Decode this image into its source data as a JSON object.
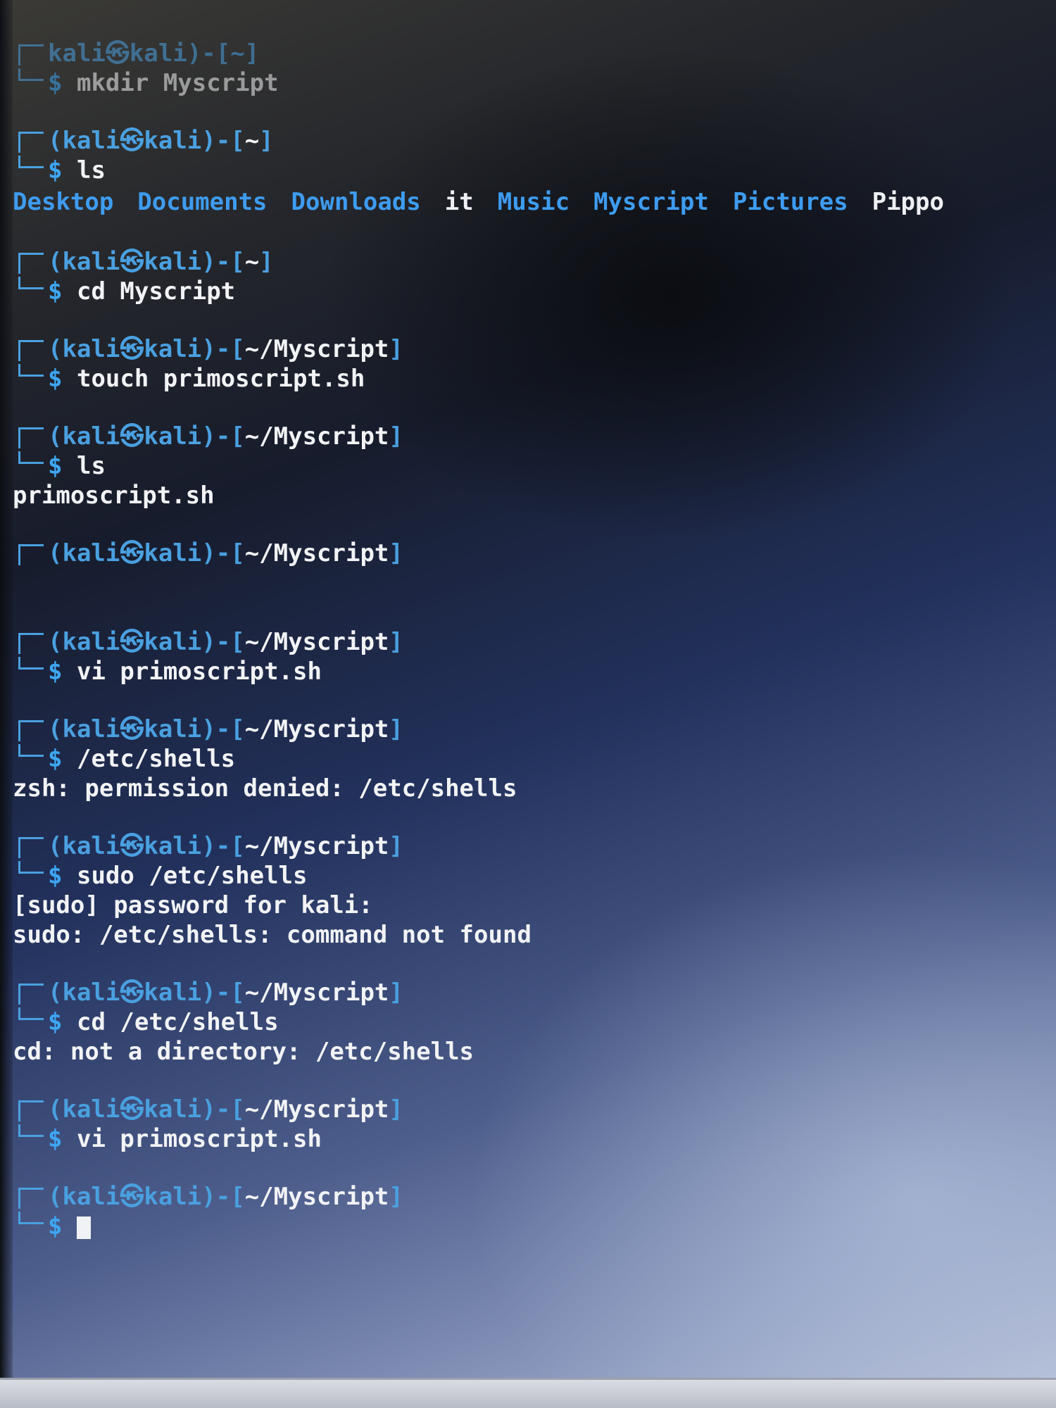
{
  "prompt": {
    "user": "kali",
    "at_symbol": "㉿",
    "host": "kali",
    "dollar": "$",
    "color_prompt": "#4aa0e0",
    "color_dir": "#3e9cf0",
    "color_text": "#e6e8ec"
  },
  "entries": [
    {
      "path": "~",
      "command": "mkdir Myscript",
      "output": []
    },
    {
      "path": "~",
      "command": "ls",
      "output": []
    },
    {
      "path": "~",
      "command": "cd Myscript",
      "output": []
    },
    {
      "path": "~/Myscript",
      "command": "touch primoscript.sh",
      "output": []
    },
    {
      "path": "~/Myscript",
      "command": "ls",
      "output": [
        "primoscript.sh"
      ]
    },
    {
      "path": "~/Myscript",
      "command": "",
      "output": []
    },
    {
      "path": "~/Myscript",
      "command": "vi primoscript.sh",
      "output": []
    },
    {
      "path": "~/Myscript",
      "command": "/etc/shells",
      "output": [
        "zsh: permission denied: /etc/shells"
      ]
    },
    {
      "path": "~/Myscript",
      "command": "sudo /etc/shells",
      "output": [
        "[sudo] password for kali:",
        "sudo: /etc/shells: command not found"
      ]
    },
    {
      "path": "~/Myscript",
      "command": "cd /etc/shells",
      "output": [
        "cd: not a directory: /etc/shells"
      ]
    },
    {
      "path": "~/Myscript",
      "command": "vi primoscript.sh",
      "output": []
    },
    {
      "path": "~/Myscript",
      "command": "",
      "output": []
    }
  ],
  "ls_home": {
    "dirs": [
      "Desktop",
      "Documents",
      "Downloads"
    ],
    "file1": "it",
    "dirs2": [
      "Music",
      "Myscript",
      "Pictures"
    ],
    "file2": "Pippo"
  }
}
